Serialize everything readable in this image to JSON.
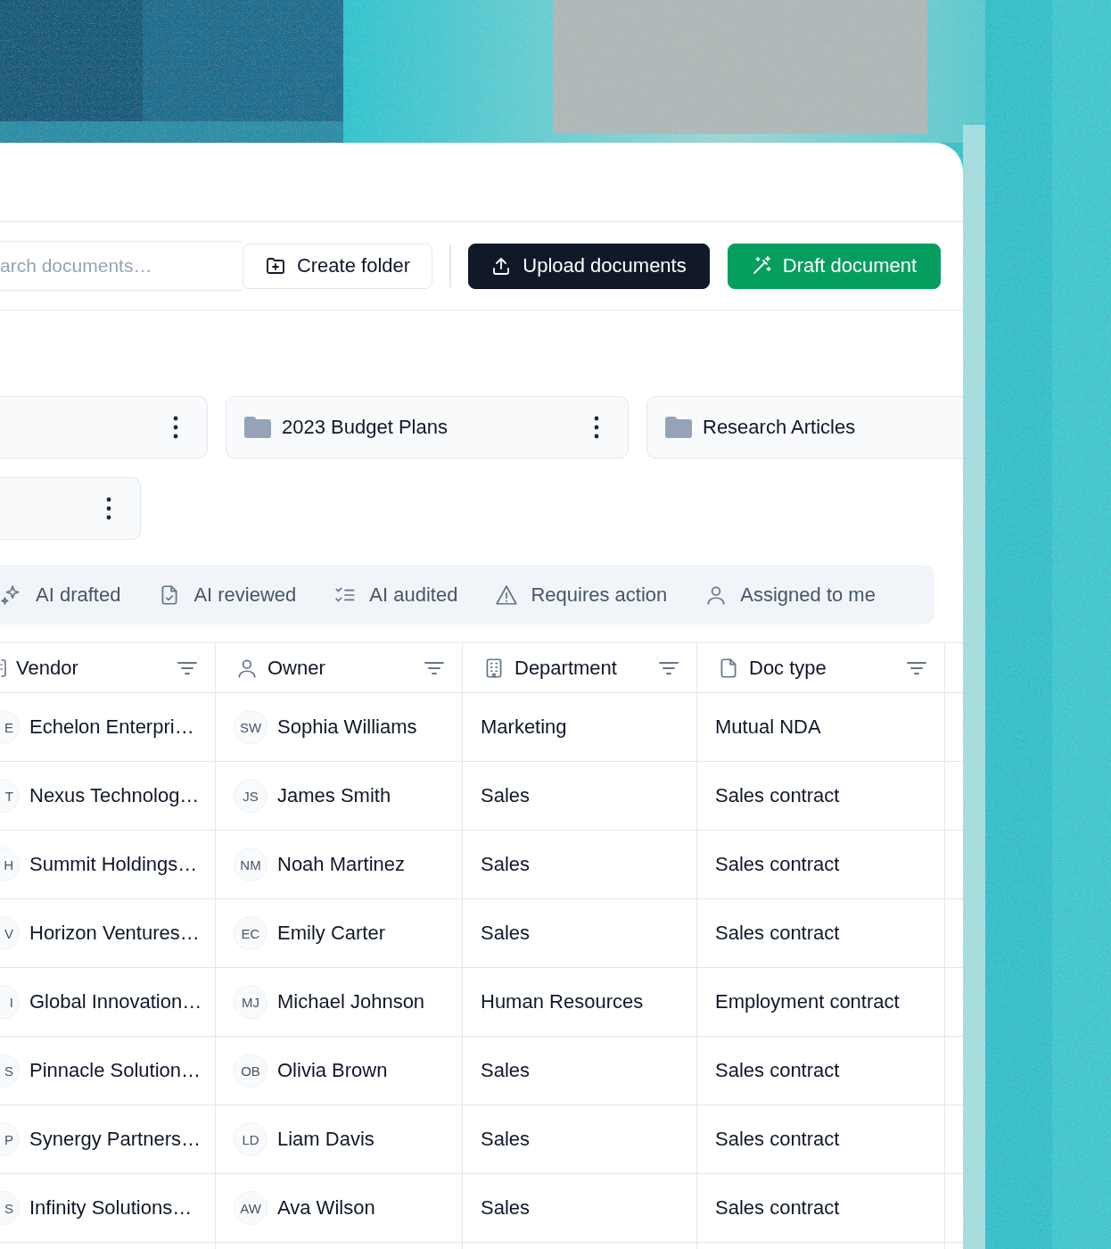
{
  "toolbar": {
    "search": {
      "placeholder": "arch documents…"
    },
    "buttons": [
      {
        "label": "Create folder",
        "kind": "outline"
      },
      {
        "label": "Upload documents",
        "kind": "dark"
      },
      {
        "label": "Draft document",
        "kind": "green"
      }
    ]
  },
  "folders": [
    {
      "has_menu": true
    },
    {
      "name": "2023 Budget Plans",
      "has_menu": true
    },
    {
      "name": "Research Articles",
      "has_menu": false
    },
    {
      "has_menu": true
    }
  ],
  "filter_tabs": [
    {
      "label": "AI drafted",
      "kind": "sparkle",
      "selected": false
    },
    {
      "label": "AI reviewed",
      "kind": "file-check",
      "selected": false
    },
    {
      "label": "AI audited",
      "kind": "checklist",
      "selected": false
    },
    {
      "label": "Requires action",
      "kind": "warning",
      "selected": false
    },
    {
      "label": "Assigned to me",
      "kind": "person",
      "selected": false
    }
  ],
  "table": {
    "columns": [
      {
        "label": "Vendor",
        "kind": "building-partial"
      },
      {
        "label": "Owner",
        "kind": "person"
      },
      {
        "label": "Department",
        "kind": "building"
      },
      {
        "label": "Doc type",
        "kind": "file"
      }
    ],
    "rows": [
      {
        "vendor_initials": "E",
        "vendor": "Echelon Enterpri…",
        "owner_initials": "SW",
        "owner": "Sophia Williams",
        "department": "Marketing",
        "doc_type": "Mutual NDA"
      },
      {
        "vendor_initials": "T",
        "vendor": "Nexus Technolog…",
        "owner_initials": "JS",
        "owner": "James Smith",
        "department": "Sales",
        "doc_type": "Sales contract"
      },
      {
        "vendor_initials": "H",
        "vendor": "Summit Holdings…",
        "owner_initials": "NM",
        "owner": "Noah Martinez",
        "department": "Sales",
        "doc_type": "Sales contract"
      },
      {
        "vendor_initials": "V",
        "vendor": "Horizon Ventures…",
        "owner_initials": "EC",
        "owner": "Emily Carter",
        "department": "Sales",
        "doc_type": "Sales contract"
      },
      {
        "vendor_initials": "I",
        "vendor": "Global Innovation…",
        "owner_initials": "MJ",
        "owner": "Michael Johnson",
        "department": "Human Resources",
        "doc_type": "Employment contract"
      },
      {
        "vendor_initials": "S",
        "vendor": "Pinnacle Solution…",
        "owner_initials": "OB",
        "owner": "Olivia Brown",
        "department": "Sales",
        "doc_type": "Sales contract"
      },
      {
        "vendor_initials": "P",
        "vendor": "Synergy Partners…",
        "owner_initials": "LD",
        "owner": "Liam Davis",
        "department": "Sales",
        "doc_type": "Sales contract"
      },
      {
        "vendor_initials": "S",
        "vendor": "Infinity Solutions…",
        "owner_initials": "AW",
        "owner": "Ava Wilson",
        "department": "Sales",
        "doc_type": "Sales contract"
      }
    ]
  }
}
